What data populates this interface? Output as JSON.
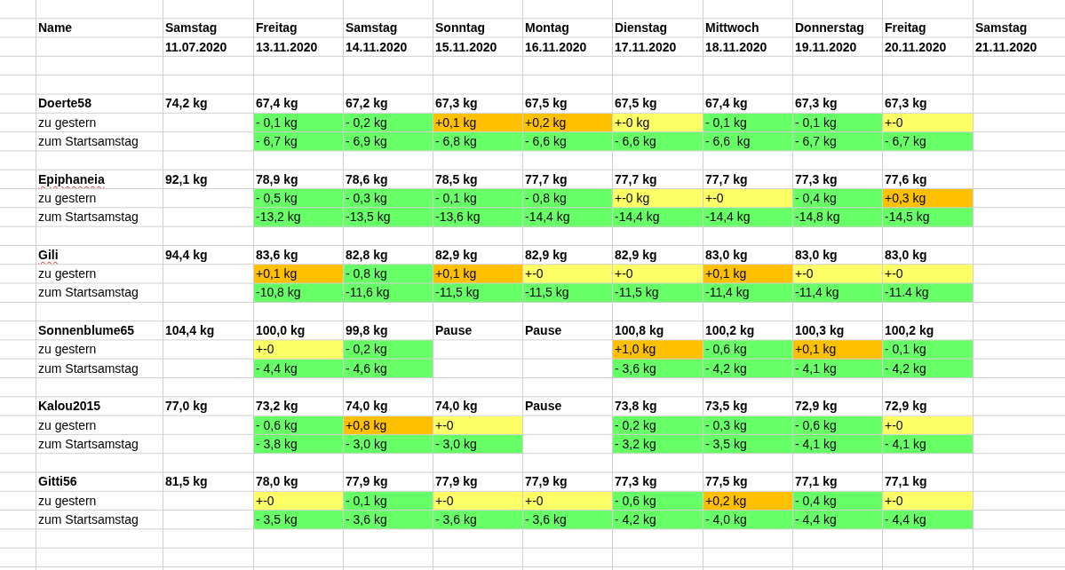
{
  "header": {
    "name_label": "Name",
    "columns": [
      {
        "day": "Samstag",
        "date": "11.07.2020"
      },
      {
        "day": "Freitag",
        "date": "13.11.2020"
      },
      {
        "day": "Samstag",
        "date": "14.11.2020"
      },
      {
        "day": "Sonntag",
        "date": "15.11.2020"
      },
      {
        "day": "Montag",
        "date": "16.11.2020"
      },
      {
        "day": "Dienstag",
        "date": "17.11.2020"
      },
      {
        "day": "Mittwoch",
        "date": "18.11.2020"
      },
      {
        "day": "Donnerstag",
        "date": "19.11.2020"
      },
      {
        "day": "Freitag",
        "date": "20.11.2020"
      },
      {
        "day": "Samstag",
        "date": "21.11.2020"
      }
    ]
  },
  "people": [
    {
      "name": "Doerte58",
      "misspelled": false,
      "start": "74,2 kg",
      "change_label": "zu gestern",
      "total_label": "zum Startsamstag",
      "days": [
        {
          "weight": "67,4 kg",
          "change": {
            "text": "- 0,1 kg",
            "color": "#66ff66"
          },
          "total": {
            "text": "- 6,7 kg",
            "color": "#66ff66"
          }
        },
        {
          "weight": "67,2 kg",
          "change": {
            "text": "- 0,2 kg",
            "color": "#66ff66"
          },
          "total": {
            "text": "- 6,9 kg",
            "color": "#66ff66"
          }
        },
        {
          "weight": "67,3 kg",
          "change": {
            "text": "+0,1 kg",
            "color": "#ffc000"
          },
          "total": {
            "text": "- 6,8 kg",
            "color": "#66ff66"
          }
        },
        {
          "weight": "67,5 kg",
          "change": {
            "text": "+0,2 kg",
            "color": "#ffc000"
          },
          "total": {
            "text": "- 6,6 kg",
            "color": "#66ff66"
          }
        },
        {
          "weight": "67,5 kg",
          "change": {
            "text": "+-0 kg",
            "color": "#ffff66"
          },
          "total": {
            "text": "- 6,6 kg",
            "color": "#66ff66"
          }
        },
        {
          "weight": "67,4 kg",
          "change": {
            "text": "- 0,1 kg",
            "color": "#66ff66"
          },
          "total": {
            "text": "- 6,6  kg",
            "color": "#66ff66"
          }
        },
        {
          "weight": "67,3 kg",
          "change": {
            "text": "- 0,1 kg",
            "color": "#66ff66"
          },
          "total": {
            "text": "- 6,7 kg",
            "color": "#66ff66"
          }
        },
        {
          "weight": "67,3 kg",
          "change": {
            "text": "+-0",
            "color": "#ffff66"
          },
          "total": {
            "text": "- 6,7 kg",
            "color": "#66ff66"
          }
        }
      ]
    },
    {
      "name": "Epiphaneia",
      "misspelled": true,
      "start": "92,1 kg",
      "change_label": "zu gestern",
      "total_label": "zum Startsamstag",
      "days": [
        {
          "weight": "78,9 kg",
          "change": {
            "text": "- 0,5 kg",
            "color": "#66ff66"
          },
          "total": {
            "text": "-13,2 kg",
            "color": "#66ff66"
          }
        },
        {
          "weight": "78,6 kg",
          "change": {
            "text": "- 0,3 kg",
            "color": "#66ff66"
          },
          "total": {
            "text": "-13,5 kg",
            "color": "#66ff66"
          }
        },
        {
          "weight": "78,5 kg",
          "change": {
            "text": "- 0,1 kg",
            "color": "#66ff66"
          },
          "total": {
            "text": "-13,6 kg",
            "color": "#66ff66"
          }
        },
        {
          "weight": "77,7 kg",
          "change": {
            "text": "- 0,8 kg",
            "color": "#66ff66"
          },
          "total": {
            "text": "-14,4 kg",
            "color": "#66ff66"
          }
        },
        {
          "weight": "77,7 kg",
          "change": {
            "text": "+-0 kg",
            "color": "#ffff66"
          },
          "total": {
            "text": "-14,4 kg",
            "color": "#66ff66"
          }
        },
        {
          "weight": "77,7 kg",
          "change": {
            "text": "+-0",
            "color": "#ffff66"
          },
          "total": {
            "text": "-14,4 kg",
            "color": "#66ff66"
          }
        },
        {
          "weight": "77,3 kg",
          "change": {
            "text": "- 0,4 kg",
            "color": "#66ff66"
          },
          "total": {
            "text": "-14,8 kg",
            "color": "#66ff66"
          }
        },
        {
          "weight": "77,6 kg",
          "change": {
            "text": "+0,3 kg",
            "color": "#ffc000"
          },
          "total": {
            "text": "-14,5 kg",
            "color": "#66ff66"
          }
        }
      ]
    },
    {
      "name": "Gili",
      "misspelled": true,
      "start": "94,4 kg",
      "change_label": "zu gestern",
      "total_label": "zum Startsamstag",
      "days": [
        {
          "weight": "83,6 kg",
          "change": {
            "text": "+0,1 kg",
            "color": "#ffc000"
          },
          "total": {
            "text": "-10,8 kg",
            "color": "#66ff66"
          }
        },
        {
          "weight": "82,8 kg",
          "change": {
            "text": "- 0,8 kg",
            "color": "#66ff66"
          },
          "total": {
            "text": "-11,6 kg",
            "color": "#66ff66"
          }
        },
        {
          "weight": "82,9 kg",
          "change": {
            "text": "+0,1 kg",
            "color": "#ffc000"
          },
          "total": {
            "text": "-11,5 kg",
            "color": "#66ff66"
          }
        },
        {
          "weight": "82,9 kg",
          "change": {
            "text": "+-0",
            "color": "#ffff66"
          },
          "total": {
            "text": "-11,5 kg",
            "color": "#66ff66"
          }
        },
        {
          "weight": "82,9 kg",
          "change": {
            "text": "+-0",
            "color": "#ffff66"
          },
          "total": {
            "text": "-11,5 kg",
            "color": "#66ff66"
          }
        },
        {
          "weight": "83,0 kg",
          "change": {
            "text": "+0,1 kg",
            "color": "#ffc000"
          },
          "total": {
            "text": "-11,4 kg",
            "color": "#66ff66"
          }
        },
        {
          "weight": "83,0 kg",
          "change": {
            "text": "+-0",
            "color": "#ffff66"
          },
          "total": {
            "text": "-11,4 kg",
            "color": "#66ff66"
          }
        },
        {
          "weight": "83,0 kg",
          "change": {
            "text": "+-0",
            "color": "#ffff66"
          },
          "total": {
            "text": "-11.4 kg",
            "color": "#66ff66"
          }
        }
      ]
    },
    {
      "name": "Sonnenblume65",
      "misspelled": false,
      "start": "104,4 kg",
      "change_label": "zu gestern",
      "total_label": "zum Startsamstag",
      "days": [
        {
          "weight": "100,0 kg",
          "change": {
            "text": "+-0",
            "color": "#ffff66"
          },
          "total": {
            "text": "- 4,4 kg",
            "color": "#66ff66"
          }
        },
        {
          "weight": "99,8 kg",
          "change": {
            "text": "- 0,2 kg",
            "color": "#66ff66"
          },
          "total": {
            "text": "- 4,6 kg",
            "color": "#66ff66"
          }
        },
        {
          "weight": "Pause"
        },
        {
          "weight": "Pause"
        },
        {
          "weight": "100,8 kg",
          "change": {
            "text": "+1,0 kg",
            "color": "#ffc000"
          },
          "total": {
            "text": "- 3,6 kg",
            "color": "#66ff66"
          }
        },
        {
          "weight": "100,2 kg",
          "change": {
            "text": "- 0,6 kg",
            "color": "#66ff66"
          },
          "total": {
            "text": "- 4,2 kg",
            "color": "#66ff66"
          }
        },
        {
          "weight": "100,3 kg",
          "change": {
            "text": "+0,1 kg",
            "color": "#ffc000"
          },
          "total": {
            "text": "- 4,1 kg",
            "color": "#66ff66"
          }
        },
        {
          "weight": "100,2 kg",
          "change": {
            "text": "- 0,1 kg",
            "color": "#66ff66"
          },
          "total": {
            "text": "- 4,2 kg",
            "color": "#66ff66"
          }
        }
      ]
    },
    {
      "name": "Kalou2015",
      "misspelled": false,
      "start": "77,0 kg",
      "change_label": "zu gestern",
      "total_label": "zum Startsamstag",
      "days": [
        {
          "weight": "73,2 kg",
          "change": {
            "text": "- 0,6 kg",
            "color": "#66ff66"
          },
          "total": {
            "text": "- 3,8 kg",
            "color": "#66ff66"
          }
        },
        {
          "weight": "74,0 kg",
          "change": {
            "text": "+0,8 kg",
            "color": "#ffc000"
          },
          "total": {
            "text": "- 3,0 kg",
            "color": "#66ff66"
          }
        },
        {
          "weight": "74,0 kg",
          "change": {
            "text": "+-0",
            "color": "#ffff66"
          },
          "total": {
            "text": "- 3,0 kg",
            "color": "#66ff66"
          }
        },
        {
          "weight": "Pause"
        },
        {
          "weight": "73,8 kg",
          "change": {
            "text": "- 0,2 kg",
            "color": "#66ff66"
          },
          "total": {
            "text": "- 3,2 kg",
            "color": "#66ff66"
          }
        },
        {
          "weight": "73,5 kg",
          "change": {
            "text": "- 0,3 kg",
            "color": "#66ff66"
          },
          "total": {
            "text": "- 3,5 kg",
            "color": "#66ff66"
          }
        },
        {
          "weight": "72,9 kg",
          "change": {
            "text": "- 0,6 kg",
            "color": "#66ff66"
          },
          "total": {
            "text": "- 4,1 kg",
            "color": "#66ff66"
          }
        },
        {
          "weight": "72,9 kg",
          "change": {
            "text": "+-0",
            "color": "#ffff66"
          },
          "total": {
            "text": "- 4,1 kg",
            "color": "#66ff66"
          }
        }
      ]
    },
    {
      "name": "Gitti56",
      "misspelled": false,
      "start": "81,5 kg",
      "change_label": "zu gestern",
      "total_label": "zum Startsamstag",
      "days": [
        {
          "weight": "78,0 kg",
          "change": {
            "text": "+-0",
            "color": "#ffff66"
          },
          "total": {
            "text": "- 3,5 kg",
            "color": "#66ff66"
          }
        },
        {
          "weight": "77,9 kg",
          "change": {
            "text": "- 0,1 kg",
            "color": "#66ff66"
          },
          "total": {
            "text": "- 3,6 kg",
            "color": "#66ff66"
          }
        },
        {
          "weight": "77,9 kg",
          "change": {
            "text": "+-0",
            "color": "#ffff66"
          },
          "total": {
            "text": "- 3,6 kg",
            "color": "#66ff66"
          }
        },
        {
          "weight": "77,9 kg",
          "change": {
            "text": "+-0",
            "color": "#ffff66"
          },
          "total": {
            "text": "- 3,6 kg",
            "color": "#66ff66"
          }
        },
        {
          "weight": "77,3 kg",
          "change": {
            "text": "- 0,6 kg",
            "color": "#66ff66"
          },
          "total": {
            "text": "- 4,2 kg",
            "color": "#66ff66"
          }
        },
        {
          "weight": "77,5 kg",
          "change": {
            "text": "+0,2 kg",
            "color": "#ffc000"
          },
          "total": {
            "text": "- 4,0 kg",
            "color": "#66ff66"
          }
        },
        {
          "weight": "77,1 kg",
          "change": {
            "text": "- 0,4 kg",
            "color": "#66ff66"
          },
          "total": {
            "text": "- 4,4 kg",
            "color": "#66ff66"
          }
        },
        {
          "weight": "77,1 kg",
          "change": {
            "text": "+-0",
            "color": "#ffff66"
          },
          "total": {
            "text": "- 4,4 kg",
            "color": "#66ff66"
          }
        }
      ]
    }
  ]
}
